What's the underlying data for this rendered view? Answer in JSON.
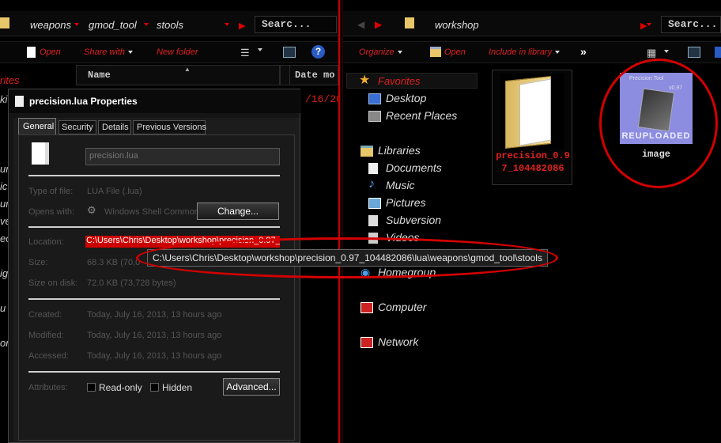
{
  "left": {
    "breadcrumbs": [
      "weapons",
      "gmod_tool",
      "stools"
    ],
    "search_placeholder": "Searc...",
    "toolbar": {
      "open": "Open",
      "share_with": "Share with",
      "new_folder": "New folder"
    },
    "nav_partial": "rites",
    "columns": {
      "name": "Name",
      "date": "Date mo"
    },
    "date_fragment": "/16/20"
  },
  "right": {
    "breadcrumbs": [
      "workshop"
    ],
    "search_placeholder": "Searc...",
    "toolbar": {
      "organize": "Organize",
      "open": "Open",
      "include_library": "Include in library",
      "more": "»"
    },
    "nav": {
      "favorites": "Favorites",
      "desktop": "Desktop",
      "recent_places": "Recent Places",
      "libraries": "Libraries",
      "documents": "Documents",
      "music": "Music",
      "pictures": "Pictures",
      "subversion": "Subversion",
      "videos": "Videos",
      "homegroup": "Homegroup",
      "computer": "Computer",
      "network": "Network"
    },
    "files": [
      {
        "name": "precision_0.97_104482086",
        "type": "folder"
      },
      {
        "name": "image",
        "type": "image",
        "thumb_title": "Precision Tool",
        "thumb_version": "v0.97",
        "thumb_banner": "REUPLOADED"
      }
    ]
  },
  "dialog": {
    "title": "precision.lua Properties",
    "tabs": [
      "General",
      "Security",
      "Details",
      "Previous Versions"
    ],
    "filename": "precision.lua",
    "type_label": "Type of file:",
    "type_value": "LUA File (.lua)",
    "opens_label": "Opens with:",
    "opens_value": "Windows Shell Commor",
    "change_button": "Change...",
    "location_label": "Location:",
    "location_value": "C:\\Users\\Chris\\Desktop\\workshop\\precision_0.97_",
    "size_label": "Size:",
    "size_value": "68.3 KB (70,0",
    "size_disk_label": "Size on disk:",
    "size_disk_value": "72.0 KB (73,728 bytes)",
    "created_label": "Created:",
    "created_value": "Today, July 16, 2013, 13 hours ago",
    "modified_label": "Modified:",
    "modified_value": "Today, July 16, 2013, 13 hours ago",
    "accessed_label": "Accessed:",
    "accessed_value": "Today, July 16, 2013, 13 hours ago",
    "attributes_label": "Attributes:",
    "readonly_label": "Read-only",
    "hidden_label": "Hidden",
    "advanced_button": "Advanced..."
  },
  "tooltip": "C:\\Users\\Chris\\Desktop\\workshop\\precision_0.97_104482086\\lua\\weapons\\gmod_tool\\stools",
  "left_edge_fragments": [
    "rites",
    "ki",
    "un",
    "ic",
    "un",
    "ve",
    "eo",
    "ig",
    "u",
    "ork"
  ],
  "colors": {
    "accent_red": "#e02020",
    "annotation_red": "#d40000",
    "background": "#000000"
  }
}
